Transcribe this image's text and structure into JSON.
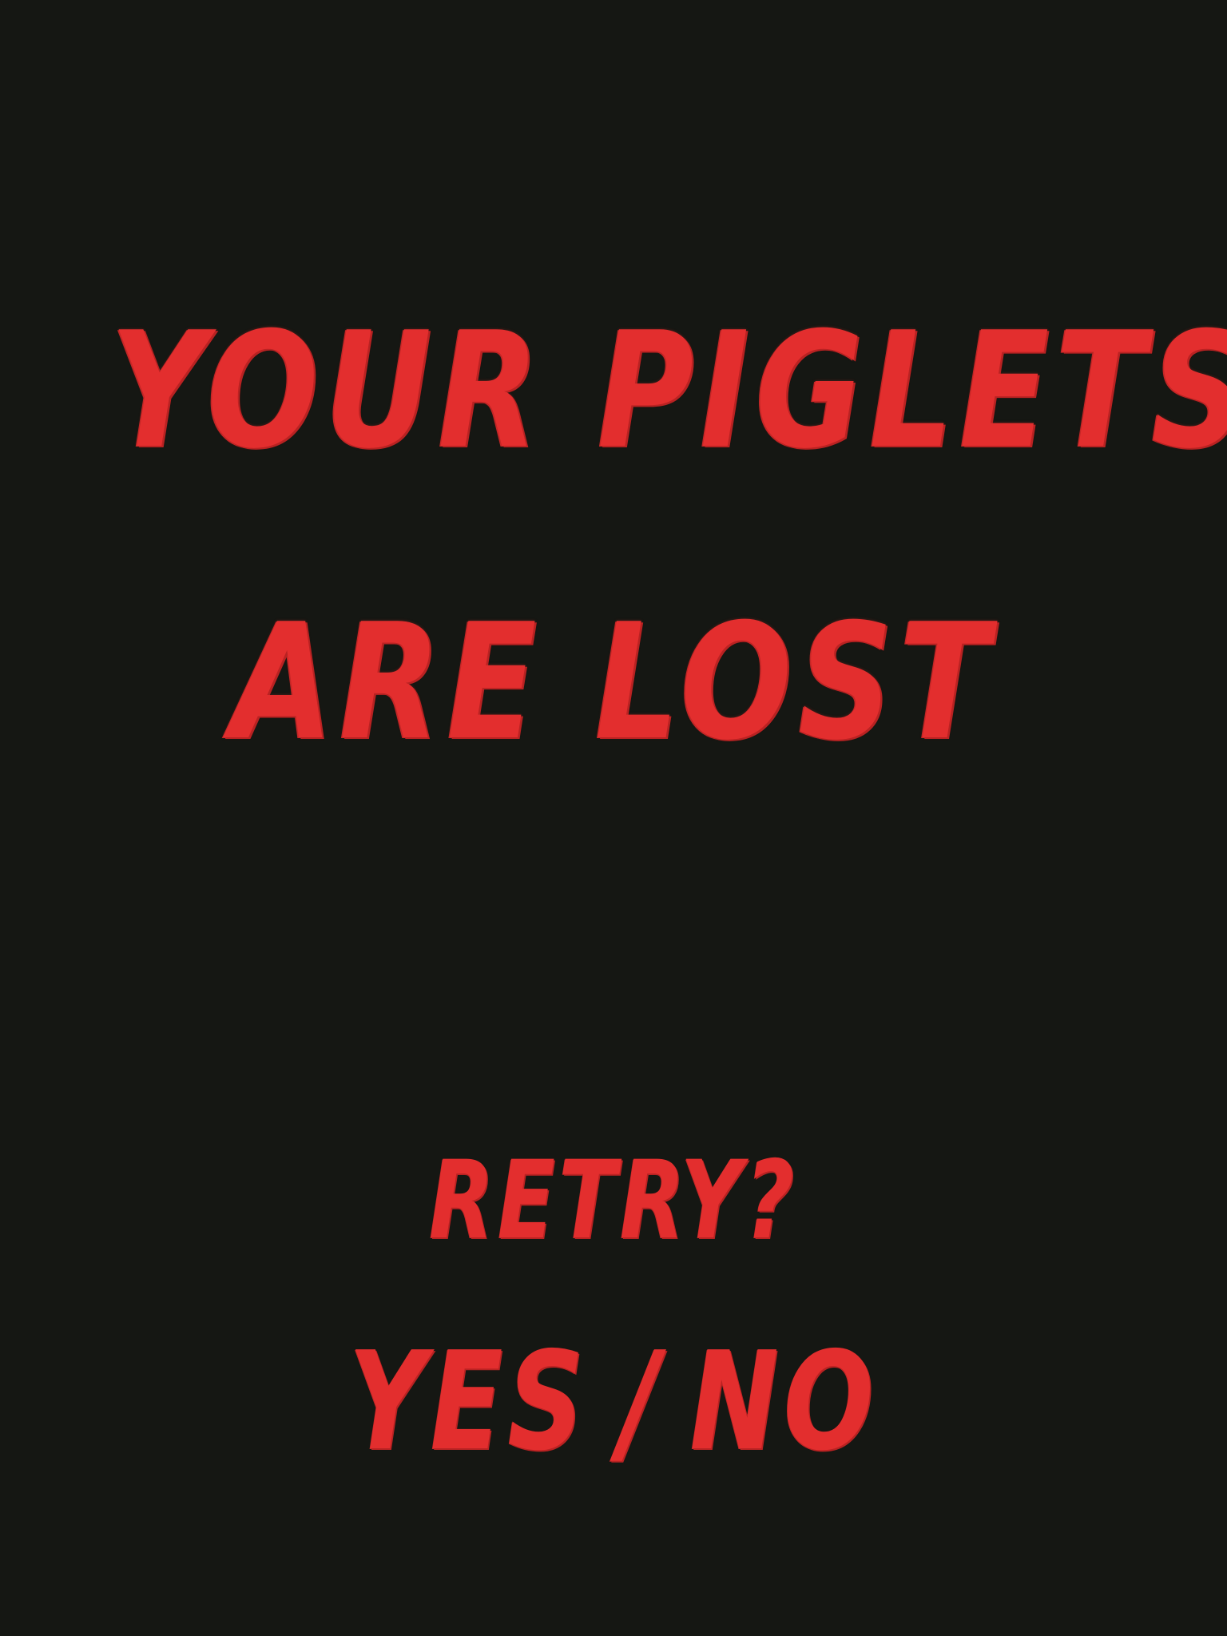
{
  "game_over": {
    "title_line_1": "YOUR PIGLETS",
    "title_line_2": "ARE LOST"
  },
  "retry": {
    "prompt": "RETRY?",
    "yes_label": "YES",
    "separator": "/",
    "no_label": "NO"
  },
  "colors": {
    "background": "#151713",
    "text": "#e32e2e"
  }
}
